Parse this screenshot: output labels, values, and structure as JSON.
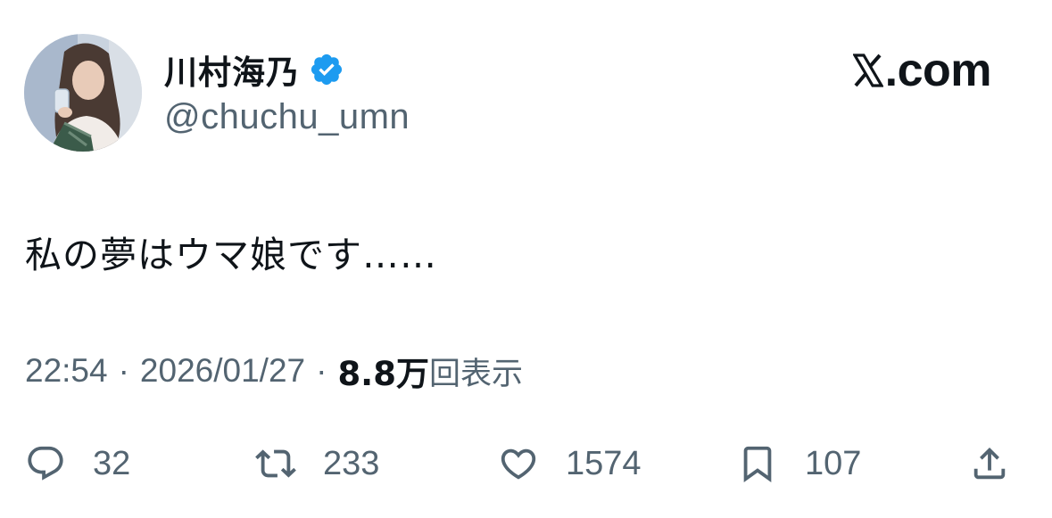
{
  "user": {
    "display_name": "川村海乃",
    "handle": "@chuchu_umn",
    "verified": true,
    "verified_color": "#1d9bf0"
  },
  "brand": {
    "text": ".com",
    "icon": "x-logo-icon"
  },
  "tweet": {
    "text": "私の夢はウマ娘です……"
  },
  "meta": {
    "time": "22:54",
    "date": "2026/01/27",
    "separator": "·",
    "views_count": "8.8万",
    "views_label": "回表示"
  },
  "actions": {
    "reply": {
      "icon": "reply-icon",
      "count": "32"
    },
    "retweet": {
      "icon": "retweet-icon",
      "count": "233"
    },
    "like": {
      "icon": "heart-icon",
      "count": "1574"
    },
    "bookmark": {
      "icon": "bookmark-icon",
      "count": "107"
    },
    "share": {
      "icon": "share-icon"
    }
  },
  "colors": {
    "primary_text": "#0f1419",
    "secondary_text": "#536471",
    "accent": "#1d9bf0"
  }
}
